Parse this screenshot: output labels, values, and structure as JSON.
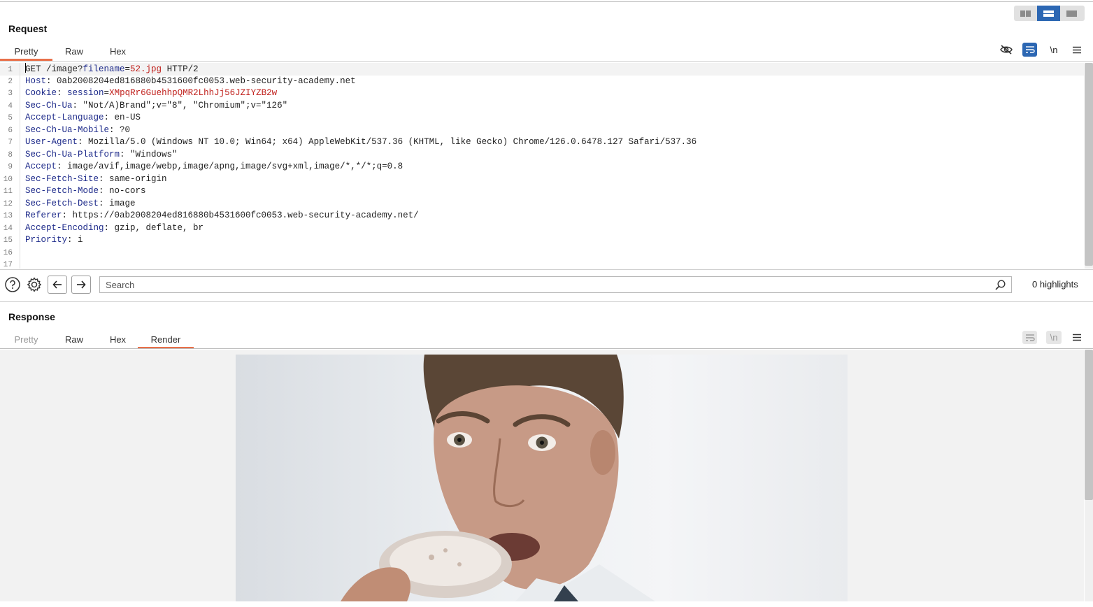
{
  "layout_toggle": {
    "options": [
      "side-by-side",
      "stacked",
      "single"
    ],
    "active": "stacked"
  },
  "request": {
    "title": "Request",
    "tabs": [
      {
        "label": "Pretty",
        "active": true
      },
      {
        "label": "Raw",
        "active": false
      },
      {
        "label": "Hex",
        "active": false
      }
    ],
    "toolbar_icons": [
      "eye-slash-icon",
      "wrap-lines-icon",
      "newline-icon",
      "menu-icon"
    ],
    "newline_label": "\\n",
    "lines": [
      {
        "n": "1",
        "parts": [
          {
            "t": "GET /image?",
            "c": "pv"
          },
          {
            "t": "filename",
            "c": "hn"
          },
          {
            "t": "=",
            "c": "pv"
          },
          {
            "t": "52.jpg",
            "c": "rv"
          },
          {
            "t": " HTTP/2",
            "c": "pv"
          }
        ]
      },
      {
        "n": "2",
        "parts": [
          {
            "t": "Host",
            "c": "hn"
          },
          {
            "t": ": 0ab2008204ed816880b4531600fc0053.web-security-academy.net",
            "c": "pv"
          }
        ]
      },
      {
        "n": "3",
        "parts": [
          {
            "t": "Cookie",
            "c": "hn"
          },
          {
            "t": ": ",
            "c": "pv"
          },
          {
            "t": "session",
            "c": "hn"
          },
          {
            "t": "=",
            "c": "pv"
          },
          {
            "t": "XMpqRr6GuehhpQMR2LhhJj56JZIYZB2w",
            "c": "rv"
          }
        ]
      },
      {
        "n": "4",
        "parts": [
          {
            "t": "Sec-Ch-Ua",
            "c": "hn"
          },
          {
            "t": ": \"Not/A)Brand\";v=\"8\", \"Chromium\";v=\"126\"",
            "c": "pv"
          }
        ]
      },
      {
        "n": "5",
        "parts": [
          {
            "t": "Accept-Language",
            "c": "hn"
          },
          {
            "t": ": en-US",
            "c": "pv"
          }
        ]
      },
      {
        "n": "6",
        "parts": [
          {
            "t": "Sec-Ch-Ua-Mobile",
            "c": "hn"
          },
          {
            "t": ": ?0",
            "c": "pv"
          }
        ]
      },
      {
        "n": "7",
        "parts": [
          {
            "t": "User-Agent",
            "c": "hn"
          },
          {
            "t": ": Mozilla/5.0 (Windows NT 10.0; Win64; x64) AppleWebKit/537.36 (KHTML, like Gecko) Chrome/126.0.6478.127 Safari/537.36",
            "c": "pv"
          }
        ]
      },
      {
        "n": "8",
        "parts": [
          {
            "t": "Sec-Ch-Ua-Platform",
            "c": "hn"
          },
          {
            "t": ": \"Windows\"",
            "c": "pv"
          }
        ]
      },
      {
        "n": "9",
        "parts": [
          {
            "t": "Accept",
            "c": "hn"
          },
          {
            "t": ": image/avif,image/webp,image/apng,image/svg+xml,image/*,*/*;q=0.8",
            "c": "pv"
          }
        ]
      },
      {
        "n": "10",
        "parts": [
          {
            "t": "Sec-Fetch-Site",
            "c": "hn"
          },
          {
            "t": ": same-origin",
            "c": "pv"
          }
        ]
      },
      {
        "n": "11",
        "parts": [
          {
            "t": "Sec-Fetch-Mode",
            "c": "hn"
          },
          {
            "t": ": no-cors",
            "c": "pv"
          }
        ]
      },
      {
        "n": "12",
        "parts": [
          {
            "t": "Sec-Fetch-Dest",
            "c": "hn"
          },
          {
            "t": ": image",
            "c": "pv"
          }
        ]
      },
      {
        "n": "13",
        "parts": [
          {
            "t": "Referer",
            "c": "hn"
          },
          {
            "t": ": https://0ab2008204ed816880b4531600fc0053.web-security-academy.net/",
            "c": "pv"
          }
        ]
      },
      {
        "n": "14",
        "parts": [
          {
            "t": "Accept-Encoding",
            "c": "hn"
          },
          {
            "t": ": gzip, deflate, br",
            "c": "pv"
          }
        ]
      },
      {
        "n": "15",
        "parts": [
          {
            "t": "Priority",
            "c": "hn"
          },
          {
            "t": ": i",
            "c": "pv"
          }
        ]
      },
      {
        "n": "16",
        "parts": []
      },
      {
        "n": "17",
        "parts": []
      }
    ]
  },
  "search": {
    "placeholder": "Search",
    "highlights": "0 highlights",
    "icons": [
      "help-icon",
      "settings-icon",
      "back-arrow-icon",
      "forward-arrow-icon",
      "search-icon"
    ]
  },
  "response": {
    "title": "Response",
    "tabs": [
      {
        "label": "Pretty",
        "active": false,
        "muted": true
      },
      {
        "label": "Raw",
        "active": false
      },
      {
        "label": "Hex",
        "active": false
      },
      {
        "label": "Render",
        "active": true
      }
    ],
    "newline_label": "\\n",
    "rendered_image": "man-eating-donut-photo"
  },
  "colors": {
    "accent": "#e8704a",
    "toggle_active": "#2c67b3",
    "header_name": "#1d2a8a",
    "red_value": "#c0201c"
  }
}
